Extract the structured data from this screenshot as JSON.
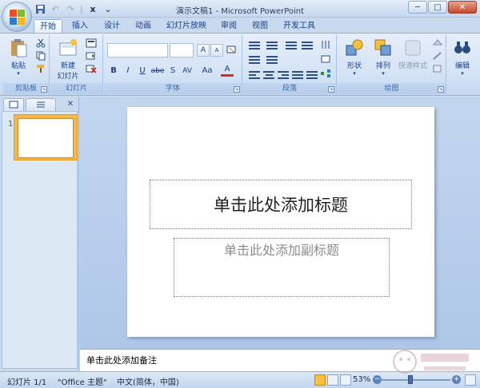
{
  "window": {
    "title": "演示文稿1 - Microsoft PowerPoint",
    "controls": [
      "─",
      "□",
      "✕"
    ]
  },
  "qat": {
    "items": [
      "save-icon",
      "undo-icon",
      "redo-icon",
      "sep",
      "customize-icon"
    ],
    "glyphs": [
      "💾",
      "↶",
      "↷",
      "x",
      "⌄"
    ]
  },
  "tabs": [
    "开始",
    "插入",
    "设计",
    "动画",
    "幻灯片放映",
    "审阅",
    "视图",
    "开发工具"
  ],
  "active_tab": "开始",
  "ribbon": {
    "clipboard": {
      "label": "剪贴板",
      "paste": "粘贴"
    },
    "slides": {
      "label": "幻灯片",
      "new_slide_1": "新建",
      "new_slide_2": "幻灯片"
    },
    "font": {
      "label": "字体",
      "font_name": "",
      "font_size": "",
      "bold": "B",
      "italic": "I",
      "underline": "U",
      "strike": "abe",
      "shadow": "S",
      "spacing": "AV",
      "case": "Aa",
      "grow": "A",
      "shrink": "A",
      "color": "A"
    },
    "paragraph": {
      "label": "段落"
    },
    "drawing": {
      "label": "绘图",
      "shapes": "形状",
      "arrange": "排列",
      "quick_styles": "快速样式"
    },
    "editing": {
      "label": "编辑"
    }
  },
  "pane": {
    "thumb_number": "1",
    "tabs": [
      "slides-tab",
      "outline-tab"
    ],
    "close": "✕"
  },
  "slide": {
    "title_placeholder": "单击此处添加标题",
    "subtitle_placeholder": "单击此处添加副标题"
  },
  "notes": {
    "placeholder": "单击此处添加备注"
  },
  "status": {
    "slide_count": "幻灯片 1/1",
    "theme": "\"Office 主题\"",
    "language": "中文(简体，中国)",
    "zoom": "53%"
  },
  "colors": {
    "ribbon": "#d3e2f5",
    "accent_orange": "#f7b84b",
    "frame": "#c9d9ee"
  }
}
